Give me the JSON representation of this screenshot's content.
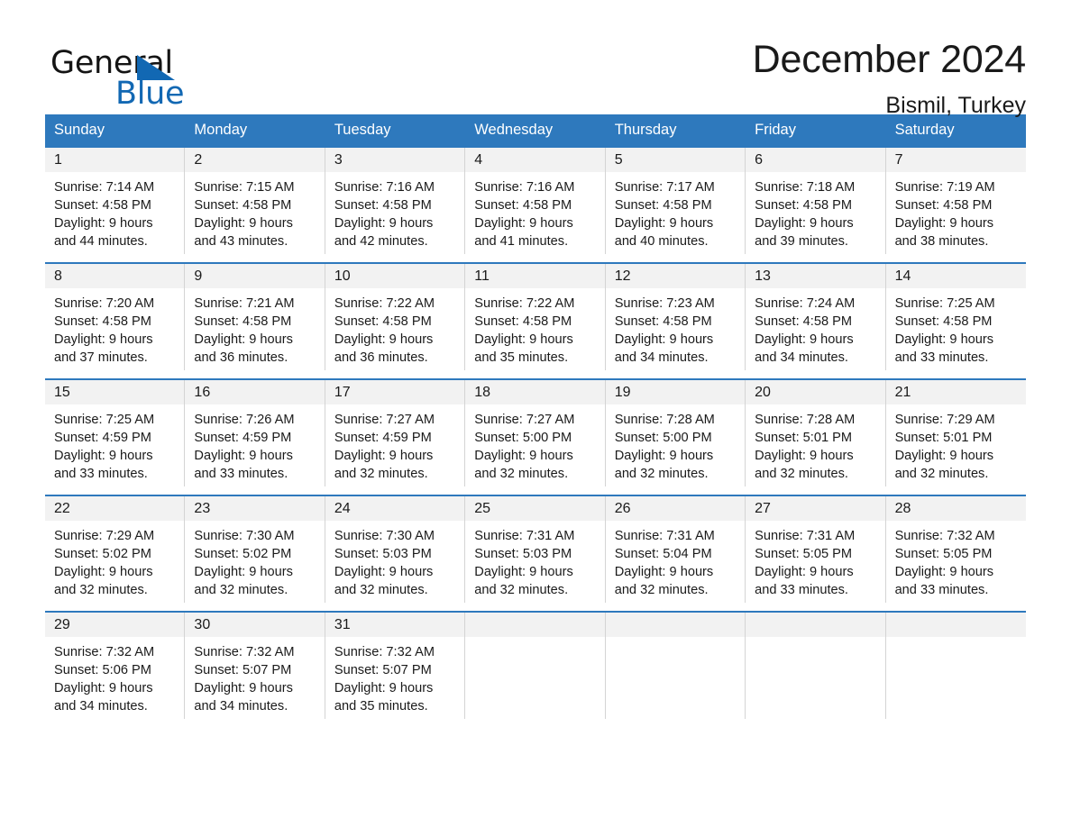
{
  "brand": {
    "name_part1": "General",
    "name_part2": "Blue",
    "triangle_icon": "blue-triangle-logo-mark",
    "colors": {
      "black": "#141414",
      "blue": "#1268b3"
    }
  },
  "header": {
    "month_title": "December 2024",
    "location": "Bismil, Turkey"
  },
  "theme": {
    "header_blue": "#2e79bd",
    "day_number_bg": "#f2f2f2",
    "grid_line": "#d4d4d4",
    "text": "#1a1a1a"
  },
  "weekdays": [
    "Sunday",
    "Monday",
    "Tuesday",
    "Wednesday",
    "Thursday",
    "Friday",
    "Saturday"
  ],
  "weeks": [
    [
      {
        "day": "1",
        "sunrise": "Sunrise: 7:14 AM",
        "sunset": "Sunset: 4:58 PM",
        "daylight_line1": "Daylight: 9 hours",
        "daylight_line2": "and 44 minutes."
      },
      {
        "day": "2",
        "sunrise": "Sunrise: 7:15 AM",
        "sunset": "Sunset: 4:58 PM",
        "daylight_line1": "Daylight: 9 hours",
        "daylight_line2": "and 43 minutes."
      },
      {
        "day": "3",
        "sunrise": "Sunrise: 7:16 AM",
        "sunset": "Sunset: 4:58 PM",
        "daylight_line1": "Daylight: 9 hours",
        "daylight_line2": "and 42 minutes."
      },
      {
        "day": "4",
        "sunrise": "Sunrise: 7:16 AM",
        "sunset": "Sunset: 4:58 PM",
        "daylight_line1": "Daylight: 9 hours",
        "daylight_line2": "and 41 minutes."
      },
      {
        "day": "5",
        "sunrise": "Sunrise: 7:17 AM",
        "sunset": "Sunset: 4:58 PM",
        "daylight_line1": "Daylight: 9 hours",
        "daylight_line2": "and 40 minutes."
      },
      {
        "day": "6",
        "sunrise": "Sunrise: 7:18 AM",
        "sunset": "Sunset: 4:58 PM",
        "daylight_line1": "Daylight: 9 hours",
        "daylight_line2": "and 39 minutes."
      },
      {
        "day": "7",
        "sunrise": "Sunrise: 7:19 AM",
        "sunset": "Sunset: 4:58 PM",
        "daylight_line1": "Daylight: 9 hours",
        "daylight_line2": "and 38 minutes."
      }
    ],
    [
      {
        "day": "8",
        "sunrise": "Sunrise: 7:20 AM",
        "sunset": "Sunset: 4:58 PM",
        "daylight_line1": "Daylight: 9 hours",
        "daylight_line2": "and 37 minutes."
      },
      {
        "day": "9",
        "sunrise": "Sunrise: 7:21 AM",
        "sunset": "Sunset: 4:58 PM",
        "daylight_line1": "Daylight: 9 hours",
        "daylight_line2": "and 36 minutes."
      },
      {
        "day": "10",
        "sunrise": "Sunrise: 7:22 AM",
        "sunset": "Sunset: 4:58 PM",
        "daylight_line1": "Daylight: 9 hours",
        "daylight_line2": "and 36 minutes."
      },
      {
        "day": "11",
        "sunrise": "Sunrise: 7:22 AM",
        "sunset": "Sunset: 4:58 PM",
        "daylight_line1": "Daylight: 9 hours",
        "daylight_line2": "and 35 minutes."
      },
      {
        "day": "12",
        "sunrise": "Sunrise: 7:23 AM",
        "sunset": "Sunset: 4:58 PM",
        "daylight_line1": "Daylight: 9 hours",
        "daylight_line2": "and 34 minutes."
      },
      {
        "day": "13",
        "sunrise": "Sunrise: 7:24 AM",
        "sunset": "Sunset: 4:58 PM",
        "daylight_line1": "Daylight: 9 hours",
        "daylight_line2": "and 34 minutes."
      },
      {
        "day": "14",
        "sunrise": "Sunrise: 7:25 AM",
        "sunset": "Sunset: 4:58 PM",
        "daylight_line1": "Daylight: 9 hours",
        "daylight_line2": "and 33 minutes."
      }
    ],
    [
      {
        "day": "15",
        "sunrise": "Sunrise: 7:25 AM",
        "sunset": "Sunset: 4:59 PM",
        "daylight_line1": "Daylight: 9 hours",
        "daylight_line2": "and 33 minutes."
      },
      {
        "day": "16",
        "sunrise": "Sunrise: 7:26 AM",
        "sunset": "Sunset: 4:59 PM",
        "daylight_line1": "Daylight: 9 hours",
        "daylight_line2": "and 33 minutes."
      },
      {
        "day": "17",
        "sunrise": "Sunrise: 7:27 AM",
        "sunset": "Sunset: 4:59 PM",
        "daylight_line1": "Daylight: 9 hours",
        "daylight_line2": "and 32 minutes."
      },
      {
        "day": "18",
        "sunrise": "Sunrise: 7:27 AM",
        "sunset": "Sunset: 5:00 PM",
        "daylight_line1": "Daylight: 9 hours",
        "daylight_line2": "and 32 minutes."
      },
      {
        "day": "19",
        "sunrise": "Sunrise: 7:28 AM",
        "sunset": "Sunset: 5:00 PM",
        "daylight_line1": "Daylight: 9 hours",
        "daylight_line2": "and 32 minutes."
      },
      {
        "day": "20",
        "sunrise": "Sunrise: 7:28 AM",
        "sunset": "Sunset: 5:01 PM",
        "daylight_line1": "Daylight: 9 hours",
        "daylight_line2": "and 32 minutes."
      },
      {
        "day": "21",
        "sunrise": "Sunrise: 7:29 AM",
        "sunset": "Sunset: 5:01 PM",
        "daylight_line1": "Daylight: 9 hours",
        "daylight_line2": "and 32 minutes."
      }
    ],
    [
      {
        "day": "22",
        "sunrise": "Sunrise: 7:29 AM",
        "sunset": "Sunset: 5:02 PM",
        "daylight_line1": "Daylight: 9 hours",
        "daylight_line2": "and 32 minutes."
      },
      {
        "day": "23",
        "sunrise": "Sunrise: 7:30 AM",
        "sunset": "Sunset: 5:02 PM",
        "daylight_line1": "Daylight: 9 hours",
        "daylight_line2": "and 32 minutes."
      },
      {
        "day": "24",
        "sunrise": "Sunrise: 7:30 AM",
        "sunset": "Sunset: 5:03 PM",
        "daylight_line1": "Daylight: 9 hours",
        "daylight_line2": "and 32 minutes."
      },
      {
        "day": "25",
        "sunrise": "Sunrise: 7:31 AM",
        "sunset": "Sunset: 5:03 PM",
        "daylight_line1": "Daylight: 9 hours",
        "daylight_line2": "and 32 minutes."
      },
      {
        "day": "26",
        "sunrise": "Sunrise: 7:31 AM",
        "sunset": "Sunset: 5:04 PM",
        "daylight_line1": "Daylight: 9 hours",
        "daylight_line2": "and 32 minutes."
      },
      {
        "day": "27",
        "sunrise": "Sunrise: 7:31 AM",
        "sunset": "Sunset: 5:05 PM",
        "daylight_line1": "Daylight: 9 hours",
        "daylight_line2": "and 33 minutes."
      },
      {
        "day": "28",
        "sunrise": "Sunrise: 7:32 AM",
        "sunset": "Sunset: 5:05 PM",
        "daylight_line1": "Daylight: 9 hours",
        "daylight_line2": "and 33 minutes."
      }
    ],
    [
      {
        "day": "29",
        "sunrise": "Sunrise: 7:32 AM",
        "sunset": "Sunset: 5:06 PM",
        "daylight_line1": "Daylight: 9 hours",
        "daylight_line2": "and 34 minutes."
      },
      {
        "day": "30",
        "sunrise": "Sunrise: 7:32 AM",
        "sunset": "Sunset: 5:07 PM",
        "daylight_line1": "Daylight: 9 hours",
        "daylight_line2": "and 34 minutes."
      },
      {
        "day": "31",
        "sunrise": "Sunrise: 7:32 AM",
        "sunset": "Sunset: 5:07 PM",
        "daylight_line1": "Daylight: 9 hours",
        "daylight_line2": "and 35 minutes."
      },
      {
        "day": "",
        "sunrise": "",
        "sunset": "",
        "daylight_line1": "",
        "daylight_line2": ""
      },
      {
        "day": "",
        "sunrise": "",
        "sunset": "",
        "daylight_line1": "",
        "daylight_line2": ""
      },
      {
        "day": "",
        "sunrise": "",
        "sunset": "",
        "daylight_line1": "",
        "daylight_line2": ""
      },
      {
        "day": "",
        "sunrise": "",
        "sunset": "",
        "daylight_line1": "",
        "daylight_line2": ""
      }
    ]
  ]
}
